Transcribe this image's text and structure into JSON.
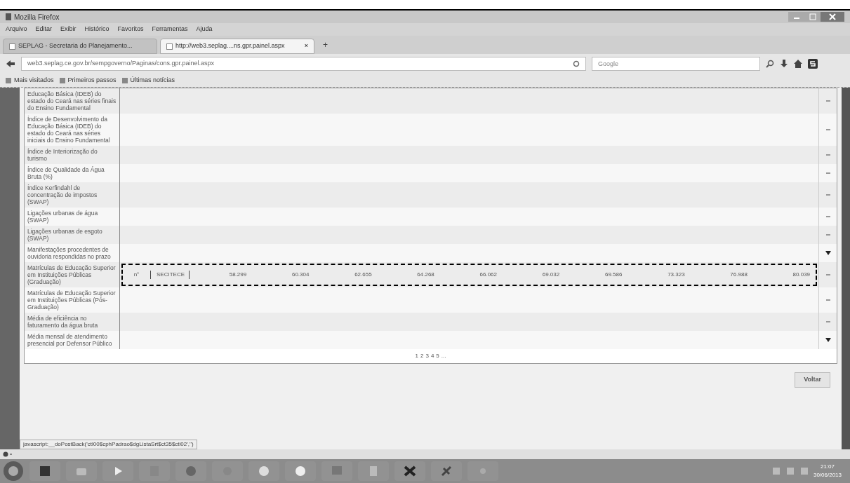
{
  "window": {
    "title": "Mozilla Firefox"
  },
  "menu": [
    "Arquivo",
    "Editar",
    "Exibir",
    "Histórico",
    "Favoritos",
    "Ferramentas",
    "Ajuda"
  ],
  "tabs": [
    {
      "label": "SEPLAG - Secretaria do Planejamento...",
      "selected": false
    },
    {
      "label": "http://web3.seplag....ns.gpr.painel.aspx",
      "selected": true,
      "close": "×"
    }
  ],
  "new_tab": "+",
  "address": {
    "value": "web3.seplag.ce.gov.br/sempgoverno/Paginas/cons.gpr.painel.aspx"
  },
  "search": {
    "placeholder": "Google"
  },
  "bookmarks": [
    "Mais visitados",
    "Primeiros passos",
    "Últimas notícias"
  ],
  "rows": [
    {
      "label": "Educação Básica (IDEB) do estado do Ceará nas séries finais do Ensino Fundamental",
      "selected": false,
      "expanded": true
    },
    {
      "label": "Índice de Desenvolvimento da Educação Básica (IDEB) do estado do Ceará nas séries iniciais do Ensino Fundamental",
      "selected": false,
      "expanded": true
    },
    {
      "label": "Índice de Interiorização do turismo",
      "selected": false,
      "expanded": true
    },
    {
      "label": "Índice de Qualidade da Água Bruta (%)",
      "selected": false,
      "expanded": true
    },
    {
      "label": "Índice Kerfindahl de concentração de impostos (SWAP)",
      "selected": false,
      "expanded": true
    },
    {
      "label": "Ligações urbanas de água (SWAP)",
      "selected": false,
      "expanded": true
    },
    {
      "label": "Ligações urbanas de esgoto (SWAP)",
      "selected": false,
      "expanded": true
    },
    {
      "label": "Manifestações procedentes de ouvidoria respondidas no prazo",
      "selected": false,
      "expanded": false
    },
    {
      "label": "Matrículas de Educação Superior em Instituições Públicas (Graduação)",
      "selected": true,
      "expanded": true,
      "unit": "n°",
      "agency": "SECITECE",
      "values": [
        "58.299",
        "60.304",
        "62.655",
        "64.268",
        "66.062",
        "69.032",
        "69.586",
        "73.323",
        "76.988",
        "80.039"
      ]
    },
    {
      "label": "Matrículas de Educação Superior em Instituições Públicas (Pós-Graduação)",
      "selected": false,
      "expanded": true
    },
    {
      "label": "Média de eficiência no faturamento da água bruta",
      "selected": false,
      "expanded": true
    },
    {
      "label": "Média mensal de atendimento presencial por Defensor Público",
      "selected": false,
      "expanded": false
    }
  ],
  "pager": [
    "1",
    "2",
    "3",
    "4",
    "5",
    "..."
  ],
  "back_button": "Voltar",
  "status_bar": "javascript:__doPostBack('ctl00$cphPadrao$dgListaSrt$ct35$ctl02','')",
  "taskbar": {
    "time": "21:07",
    "date": "30/06/2013"
  }
}
